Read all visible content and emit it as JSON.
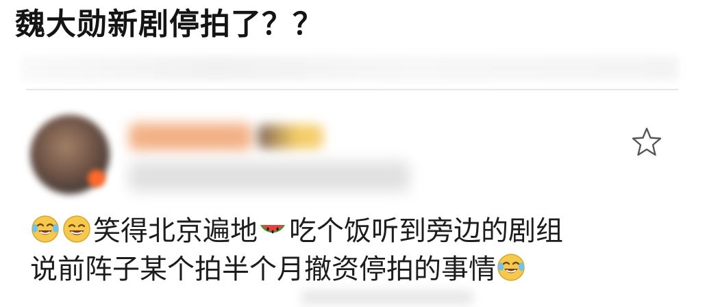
{
  "post": {
    "title": "魏大勋新剧停拍了？？"
  },
  "comment": {
    "line1_text1": "笑得北京遍地",
    "line1_text2": "吃个饭听到旁边的剧组",
    "line2_text": "说前阵子某个拍半个月撤资停拍的事情"
  },
  "icons": {
    "laugh_cry": "laugh-cry-emoji",
    "laugh": "laugh-emoji",
    "watermelon": "watermelon-emoji",
    "star": "star-outline-icon"
  },
  "colors": {
    "emoji_yellow": "#f6c84c",
    "watermelon_red": "#e2433f",
    "star_stroke": "#555555"
  }
}
